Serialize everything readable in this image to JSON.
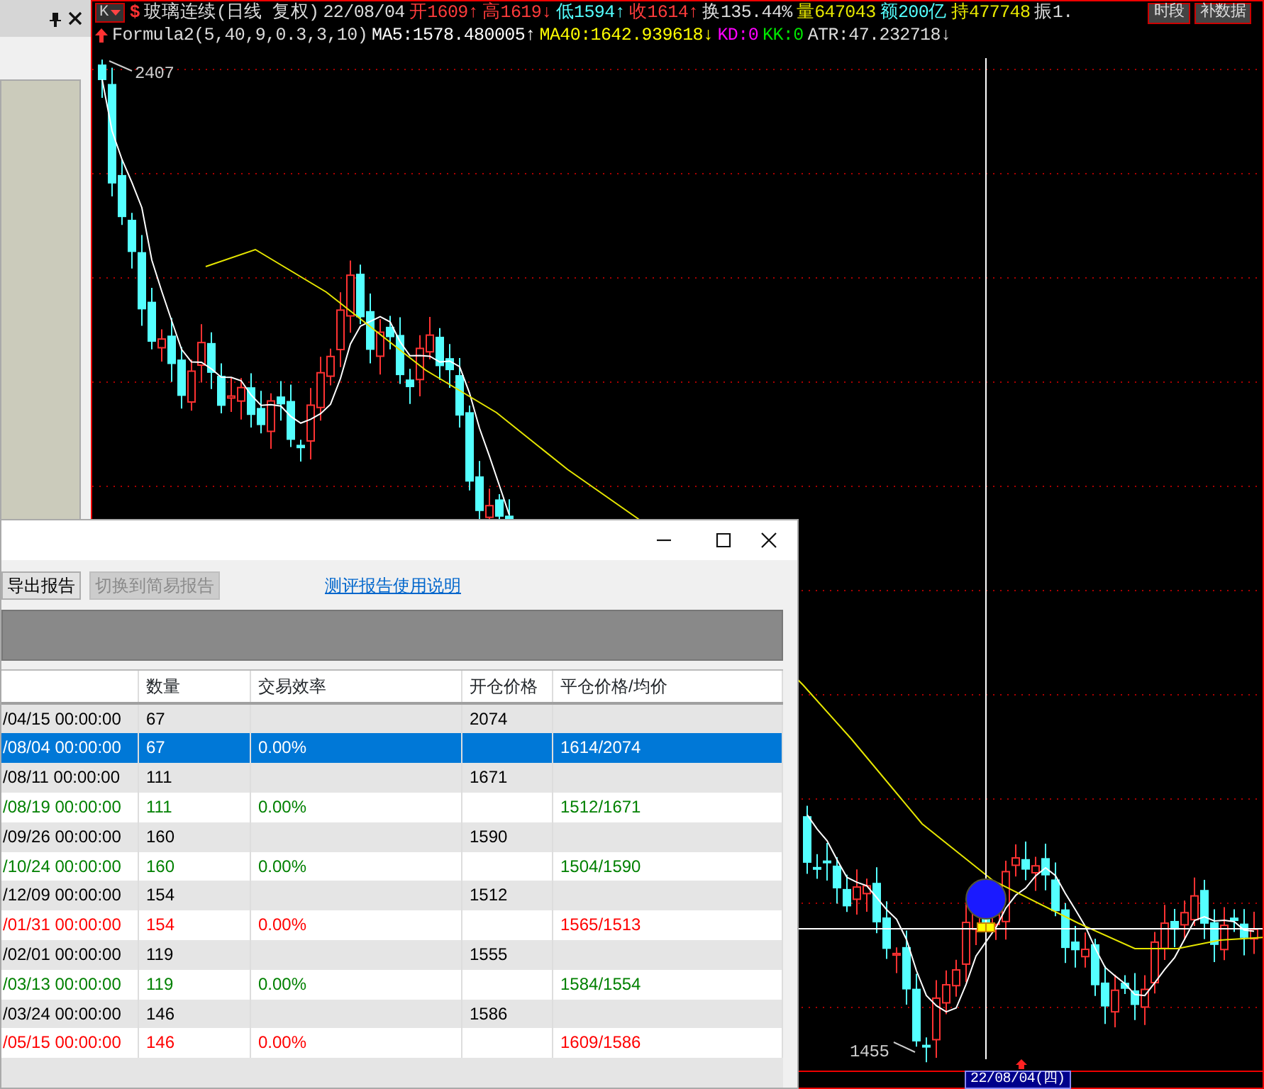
{
  "chart": {
    "mode_button": "K",
    "symbol_mark": "$",
    "title": "玻璃连续(日线 复权)",
    "date": "22/08/04",
    "quotes": [
      {
        "label": "开",
        "value": "1609",
        "arrow": "↑",
        "color": "#ff3c3c"
      },
      {
        "label": "高",
        "value": "1619",
        "arrow": "↓",
        "color": "#ff3c3c"
      },
      {
        "label": "低",
        "value": "1594",
        "arrow": "↑",
        "color": "#54ffff"
      },
      {
        "label": "收",
        "value": "1614",
        "arrow": "↑",
        "color": "#ff3c3c"
      },
      {
        "label": "换",
        "value": "135.44%",
        "color": "#dcdcdc"
      },
      {
        "label": "量",
        "value": "647043",
        "color": "#e6e600"
      },
      {
        "label": "额",
        "value": "200亿",
        "color": "#54ffff"
      },
      {
        "label": "持",
        "value": "477748",
        "color": "#e6e600"
      },
      {
        "label": "振",
        "value": "1.",
        "color": "#dcdcdc"
      }
    ],
    "buttons": [
      "时段",
      "补数据"
    ],
    "formula": "Formula2(5,40,9,0.3,3,10)",
    "indicators": [
      {
        "label": "MA5:",
        "value": "1578.480005",
        "arrow": "↑",
        "color": "#ffffff"
      },
      {
        "label": "MA40:",
        "value": "1642.939618",
        "arrow": "↓",
        "color": "#ffff00"
      },
      {
        "label": "KD:",
        "value": "0",
        "color": "#ff00ff"
      },
      {
        "label": "KK:",
        "value": "0",
        "color": "#00e600"
      },
      {
        "label": "ATR:",
        "value": "47.232718",
        "arrow": "↓",
        "color": "#dcdcdc"
      }
    ],
    "high_label": "2407",
    "low_label": "1455",
    "cursor_date": "22/08/04(四)"
  },
  "dialog": {
    "buttons": [
      {
        "label": "导出报告",
        "disabled": false
      },
      {
        "label": "切换到简易报告",
        "disabled": true
      }
    ],
    "help_link": "测评报告使用说明",
    "table": {
      "columns": [
        "数量",
        "交易效率",
        "开仓价格",
        "平仓价格/均价"
      ],
      "rows": [
        {
          "time": "/04/15 00:00:00",
          "quantity": "67",
          "open_price": "2074",
          "color": "#000000",
          "selected": false
        },
        {
          "time": "/08/04 00:00:00",
          "quantity": "67",
          "efficiency": "0.00%",
          "close_price": "1614/2074",
          "selected": true
        },
        {
          "time": "/08/11 00:00:00",
          "quantity": "111",
          "open_price": "1671",
          "color": "#000000",
          "selected": false
        },
        {
          "time": "/08/19 00:00:00",
          "quantity": "111",
          "efficiency": "0.00%",
          "close_price": "1512/1671",
          "color": "#008000",
          "selected": false
        },
        {
          "time": "/09/26 00:00:00",
          "quantity": "160",
          "open_price": "1590",
          "color": "#000000",
          "selected": false
        },
        {
          "time": "/10/24 00:00:00",
          "quantity": "160",
          "efficiency": "0.00%",
          "close_price": "1504/1590",
          "color": "#008000",
          "selected": false
        },
        {
          "time": "/12/09 00:00:00",
          "quantity": "154",
          "open_price": "1512",
          "color": "#000000",
          "selected": false
        },
        {
          "time": "/01/31 00:00:00",
          "quantity": "154",
          "efficiency": "0.00%",
          "close_price": "1565/1513",
          "color": "#ff0000",
          "selected": false
        },
        {
          "time": "/02/01 00:00:00",
          "quantity": "119",
          "open_price": "1555",
          "color": "#000000",
          "selected": false
        },
        {
          "time": "/03/13 00:00:00",
          "quantity": "119",
          "efficiency": "0.00%",
          "close_price": "1584/1554",
          "color": "#008000",
          "selected": false
        },
        {
          "time": "/03/24 00:00:00",
          "quantity": "146",
          "open_price": "1586",
          "color": "#000000",
          "selected": false
        },
        {
          "time": "/05/15 00:00:00",
          "quantity": "146",
          "efficiency": "0.00%",
          "close_price": "1609/1586",
          "color": "#ff0000",
          "selected": false
        }
      ]
    }
  }
}
